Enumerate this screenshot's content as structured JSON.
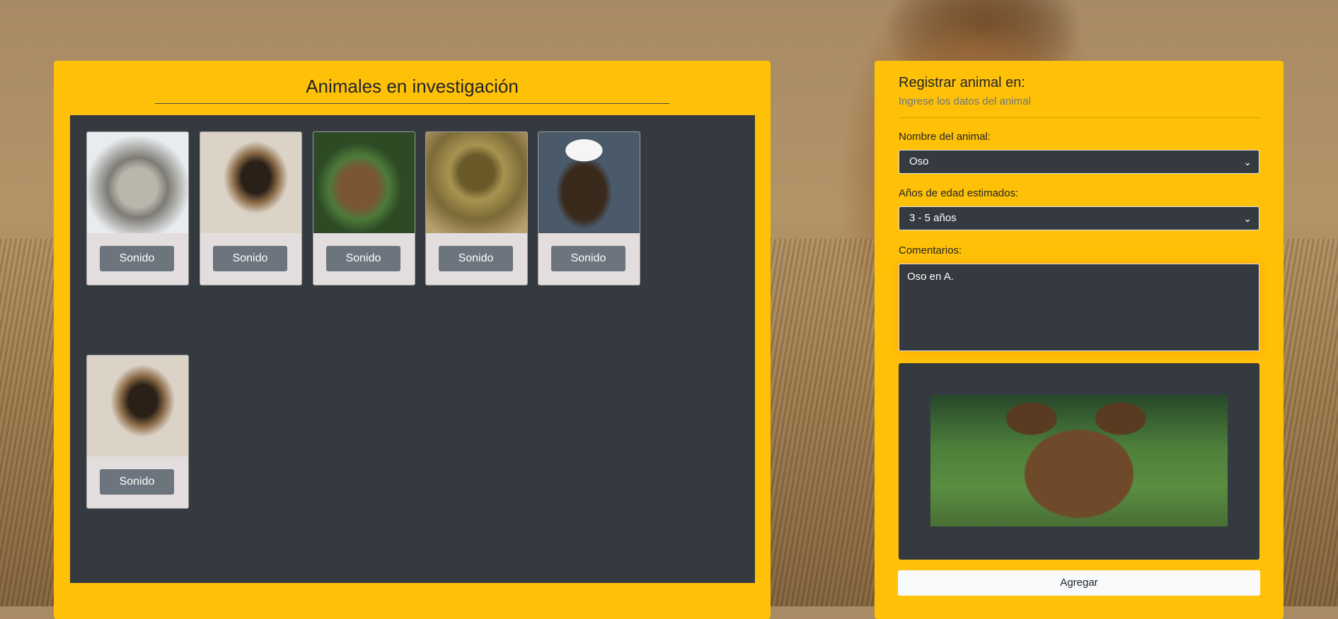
{
  "gallery": {
    "title": "Animales en investigación",
    "cards": [
      {
        "animal": "wolf",
        "button_label": "Sonido"
      },
      {
        "animal": "lion",
        "button_label": "Sonido"
      },
      {
        "animal": "bear",
        "button_label": "Sonido"
      },
      {
        "animal": "snake",
        "button_label": "Sonido"
      },
      {
        "animal": "eagle",
        "button_label": "Sonido"
      },
      {
        "animal": "lion",
        "button_label": "Sonido"
      }
    ]
  },
  "form": {
    "title": "Registrar animal en:",
    "subtitle": "Ingrese los datos del animal",
    "animal_label": "Nombre del animal:",
    "animal_value": "Oso",
    "age_label": "Años de edad estimados:",
    "age_value": "3 - 5 años",
    "comments_label": "Comentarios:",
    "comments_value": "Oso en A.",
    "add_button": "Agregar"
  },
  "colors": {
    "accent": "#ffc107",
    "dark": "#343a40",
    "button_gray": "#6c757d"
  }
}
